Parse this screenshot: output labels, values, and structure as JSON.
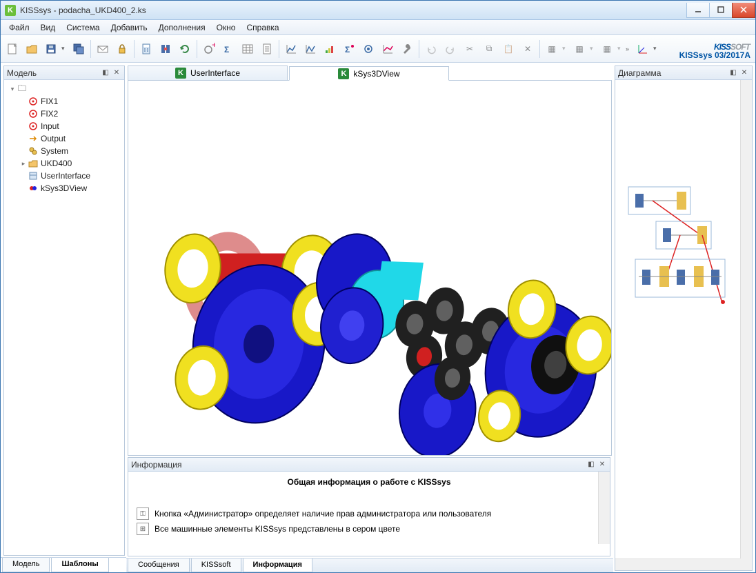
{
  "title": "KISSsys - podacha_UKD400_2.ks",
  "logo": {
    "part1": "KISS",
    "part2": "SOFT"
  },
  "version": "KISSsys 03/2017A",
  "menus": [
    "Файл",
    "Вид",
    "Система",
    "Добавить",
    "Дополнения",
    "Окно",
    "Справка"
  ],
  "panels": {
    "model": "Модель",
    "diagram": "Диаграмма",
    "info": "Информация"
  },
  "tree": {
    "root": "",
    "items": [
      {
        "label": "FIX1",
        "icon": "target"
      },
      {
        "label": "FIX2",
        "icon": "target"
      },
      {
        "label": "Input",
        "icon": "target"
      },
      {
        "label": "Output",
        "icon": "arrow"
      },
      {
        "label": "System",
        "icon": "gears"
      },
      {
        "label": "UKD400",
        "icon": "folder",
        "expandable": true
      },
      {
        "label": "UserInterface",
        "icon": "ui"
      },
      {
        "label": "kSys3DView",
        "icon": "3d"
      }
    ]
  },
  "tabs": {
    "top": [
      {
        "label": "UserInterface"
      },
      {
        "label": "kSys3DView",
        "active": true
      }
    ],
    "left": [
      {
        "label": "Модель"
      },
      {
        "label": "Шаблоны",
        "active": true
      }
    ],
    "bottom": [
      {
        "label": "Сообщения"
      },
      {
        "label": "KISSsoft"
      },
      {
        "label": "Информация",
        "active": true
      }
    ]
  },
  "info": {
    "heading": "Общая информация о работе с KISSsys",
    "lines": [
      "Кнопка «Администратор» определяет наличие прав администратора или пользователя",
      "Все машинные элементы KISSsys представлены в сером цвете"
    ]
  },
  "icons": {
    "minimize": "—",
    "maximize": "☐",
    "close": "✕",
    "pin": "⤢",
    "x": "✕",
    "expand": "▸",
    "collapse": "▾"
  }
}
